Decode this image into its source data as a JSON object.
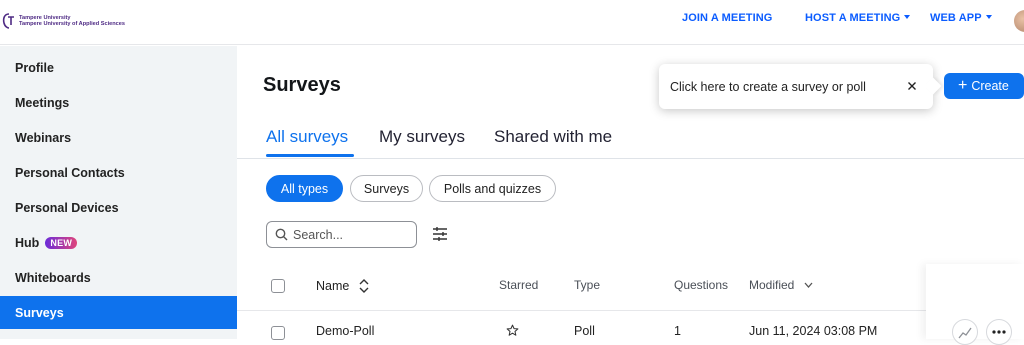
{
  "header": {
    "logo": {
      "line1": "Tampere University",
      "line2": "Tampere University of Applied Sciences",
      "icon": "tampere-university-logo"
    },
    "nav": {
      "join": "JOIN A MEETING",
      "host": "HOST A MEETING",
      "webapp": "WEB APP"
    }
  },
  "sidebar": {
    "items": [
      {
        "label": "Profile"
      },
      {
        "label": "Meetings"
      },
      {
        "label": "Webinars"
      },
      {
        "label": "Personal Contacts"
      },
      {
        "label": "Personal Devices"
      },
      {
        "label": "Hub",
        "badge": "NEW"
      },
      {
        "label": "Whiteboards"
      },
      {
        "label": "Surveys",
        "active": true
      }
    ]
  },
  "main": {
    "title": "Surveys",
    "tabs": [
      {
        "label": "All surveys",
        "active": true
      },
      {
        "label": "My surveys"
      },
      {
        "label": "Shared with me"
      }
    ],
    "filters": [
      {
        "label": "All types",
        "active": true
      },
      {
        "label": "Surveys"
      },
      {
        "label": "Polls and quizzes"
      }
    ],
    "search": {
      "placeholder": "Search..."
    },
    "create_label": "Create",
    "tooltip": {
      "text": "Click here to create a survey or poll"
    },
    "table": {
      "columns": {
        "name": "Name",
        "starred": "Starred",
        "type": "Type",
        "questions": "Questions",
        "modified": "Modified"
      },
      "rows": [
        {
          "name": "Demo-Poll",
          "starred": false,
          "type": "Poll",
          "questions": "1",
          "modified": "Jun 11, 2024 03:08 PM"
        }
      ]
    }
  },
  "colors": {
    "primary": "#0e72ed",
    "nav_link": "#0b5cff",
    "sidebar_bg": "#f1f4f6"
  }
}
